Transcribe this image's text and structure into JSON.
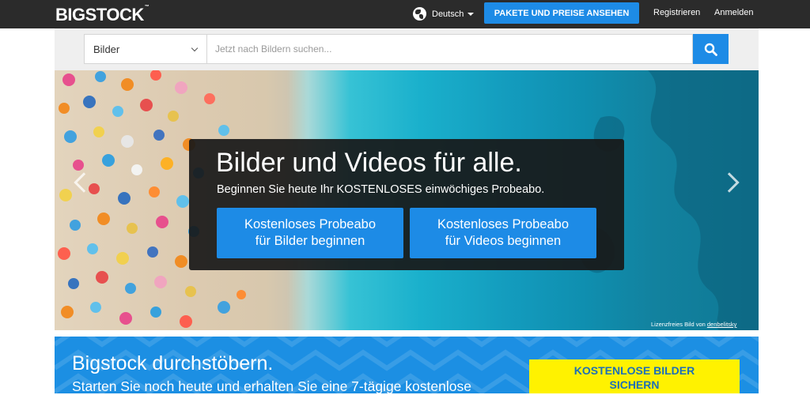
{
  "header": {
    "logo": "BIGSTOCK",
    "logo_mark": "™",
    "language": "Deutsch",
    "cta": "PAKETE UND PREISE ANSEHEN",
    "register": "Registrieren",
    "login": "Anmelden"
  },
  "search": {
    "category": "Bilder",
    "placeholder": "Jetzt nach Bildern suchen..."
  },
  "hero": {
    "title": "Bilder und Videos für alle.",
    "subtitle": "Beginnen Sie heute Ihr KOSTENLOSES einwöchiges Probeabo.",
    "button_images_line1": "Kostenloses Probeabo",
    "button_images_line2": "für Bilder beginnen",
    "button_videos_line1": "Kostenloses Probeabo",
    "button_videos_line2": "für Videos beginnen",
    "credit_prefix": "Lizenzfreies Bild von ",
    "credit_author": "denbelitsky"
  },
  "browse": {
    "title": "Bigstock durchstöbern.",
    "subtitle": "Starten Sie noch heute und erhalten Sie eine 7-tägige kostenlose",
    "cta_line1": "KOSTENLOSE BILDER",
    "cta_line2": "SICHERN"
  },
  "colors": {
    "topbar": "#2b2b2b",
    "accent": "#1d8be6",
    "cta_yellow": "#fff200"
  }
}
